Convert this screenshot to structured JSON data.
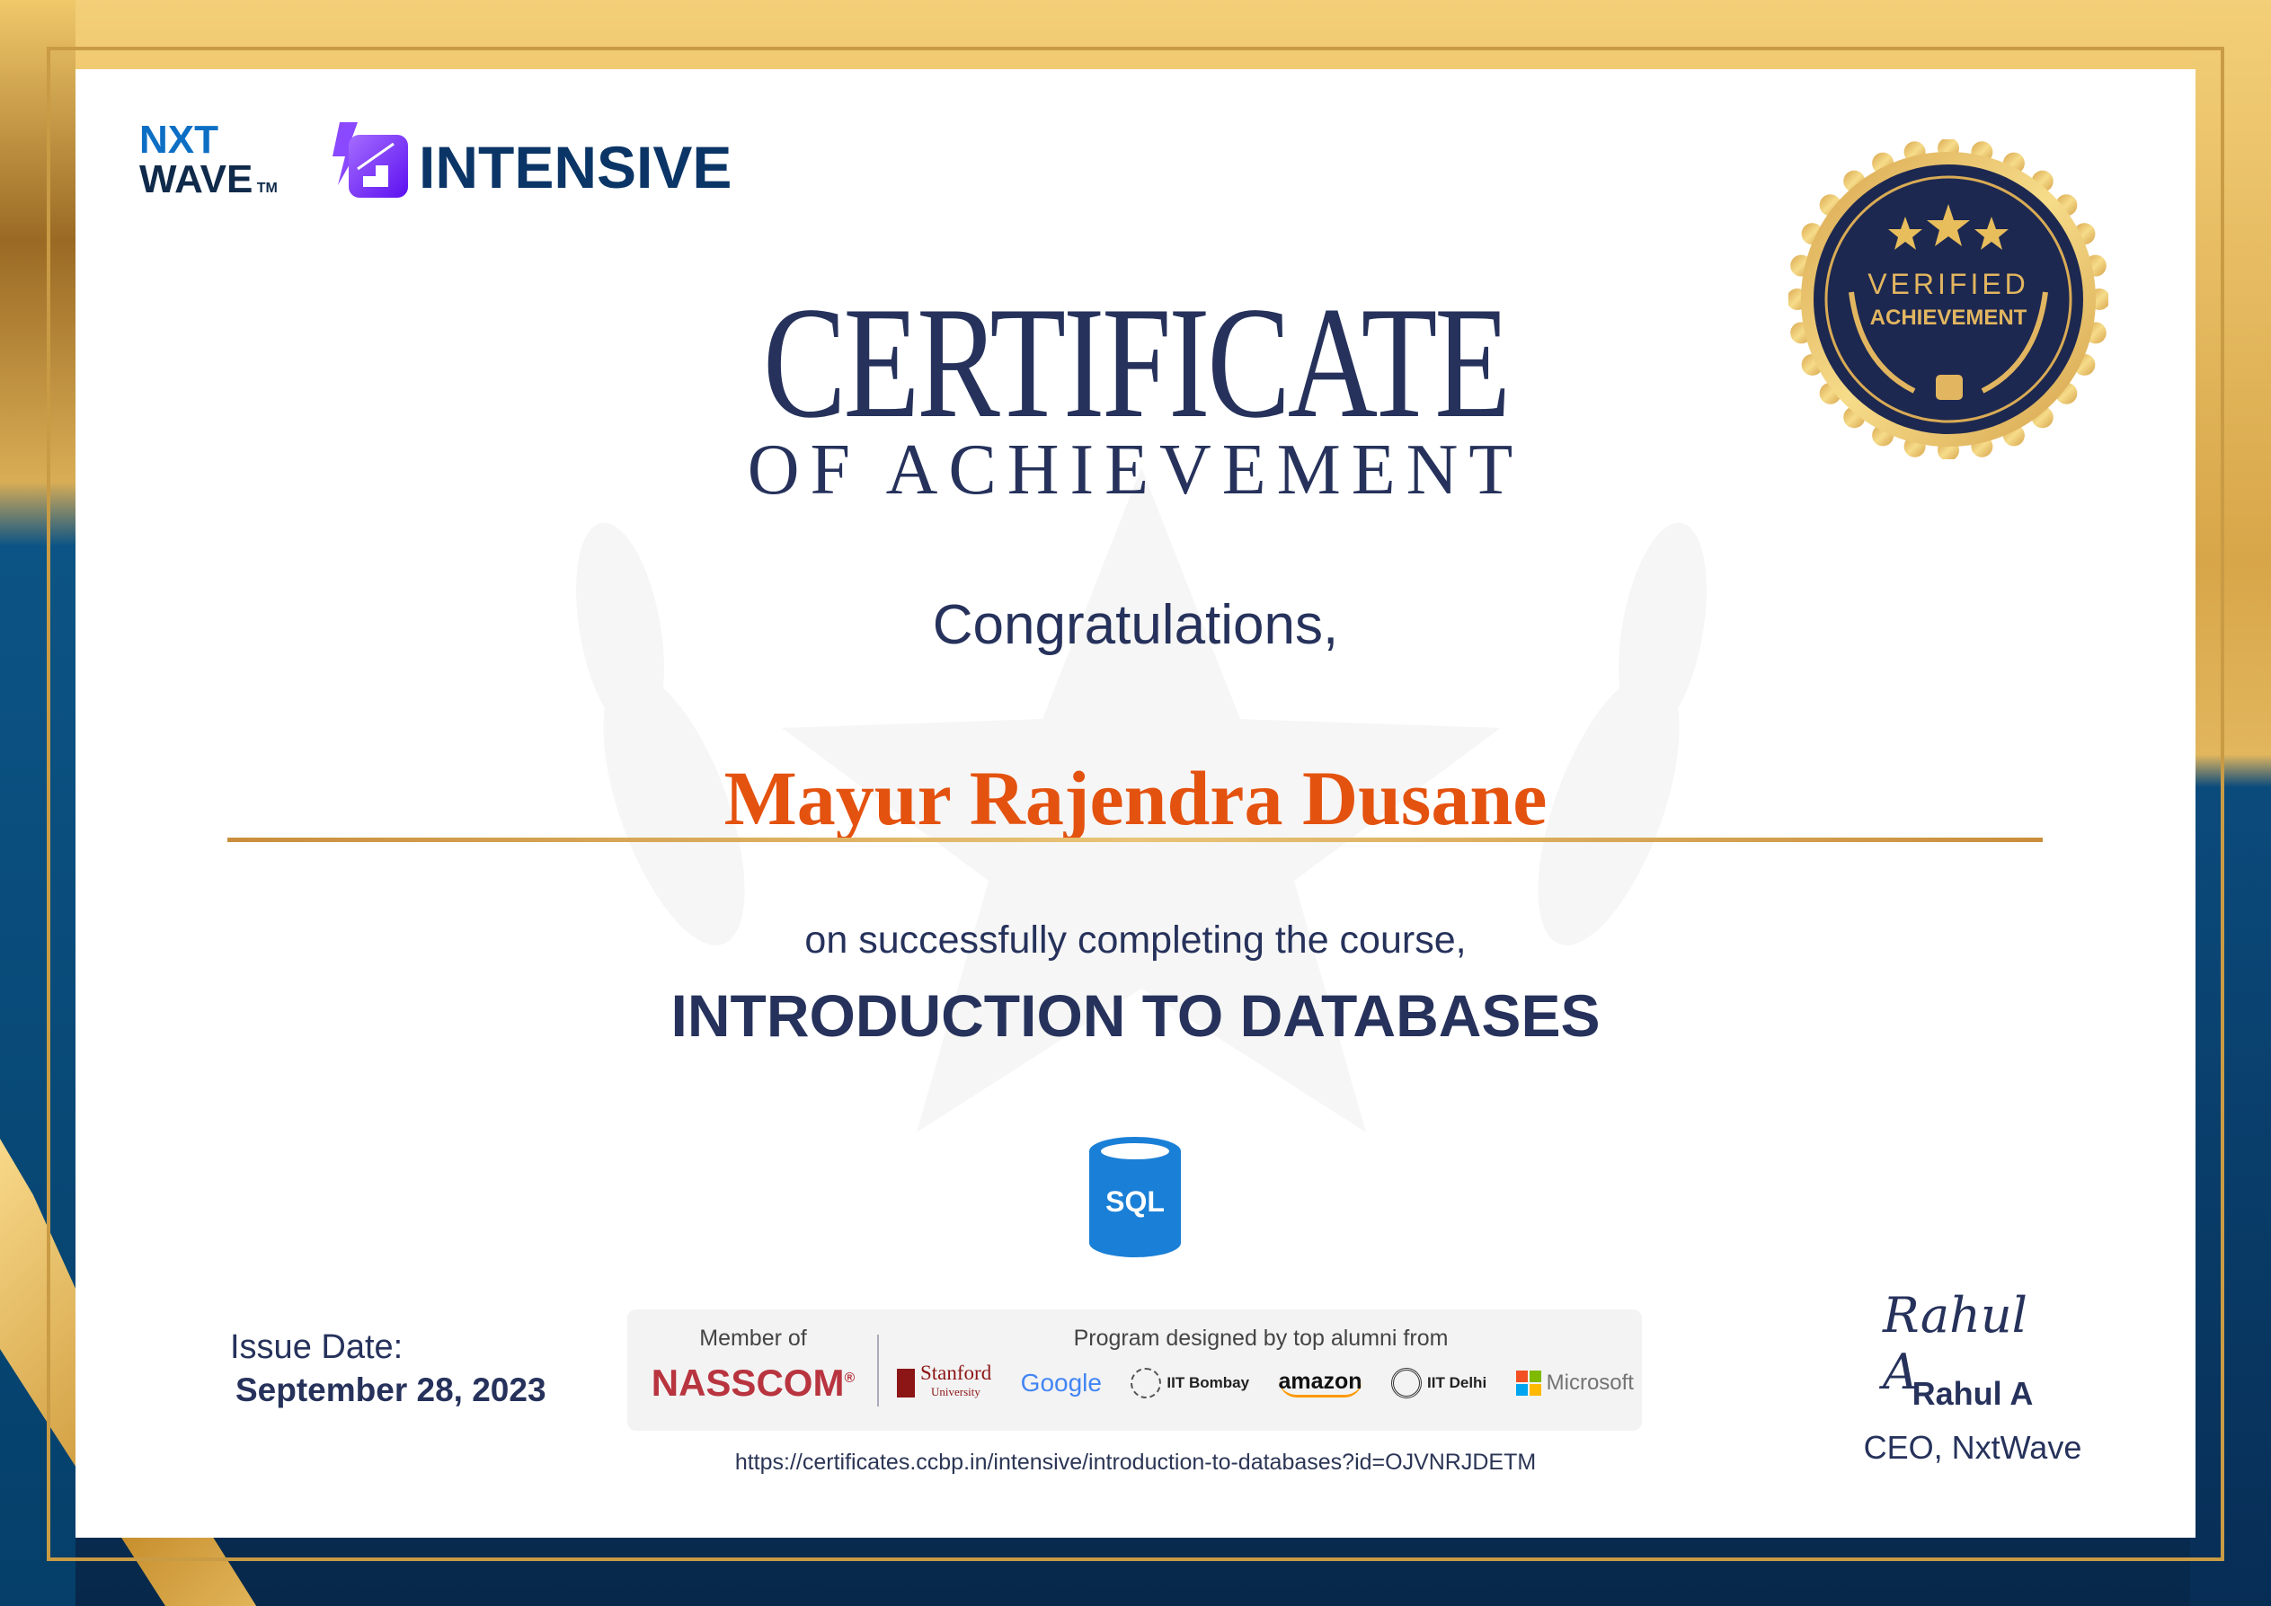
{
  "logos": {
    "nxtwave_line1": "NXT",
    "nxtwave_line2": "WAVE",
    "tm": "TM",
    "intensive": "INTENSIVE"
  },
  "seal": {
    "line1": "VERIFIED",
    "line2": "ACHIEVEMENT",
    "stars": 3
  },
  "title": "CERTIFICATE",
  "subtitle": "OF ACHIEVEMENT",
  "greeting": "Congratulations,",
  "recipient": "Mayur Rajendra Dusane",
  "completion_text": "on successfully completing the course,",
  "course": "INTRODUCTION TO DATABASES",
  "course_icon": {
    "label": "SQL",
    "name": "sql-database-icon"
  },
  "issue": {
    "label": "Issue Date:",
    "date": "September 28, 2023"
  },
  "membership": {
    "label": "Member of",
    "org": "NASSCOM",
    "reg": "®"
  },
  "alumni": {
    "label": "Program designed by top alumni from",
    "partners": [
      "Stanford",
      "University",
      "Google",
      "IIT Bombay",
      "amazon",
      "IIT Delhi",
      "Microsoft"
    ]
  },
  "url": "https://certificates.ccbp.in/intensive/introduction-to-databases?id=OJVNRJDETM",
  "signatory": {
    "signature": "Rahul A",
    "name": "Rahul A",
    "title": "CEO, NxtWave"
  },
  "colors": {
    "navy": "#26325b",
    "name_orange": "#e4520f",
    "gold": "#d9ab55",
    "intensive_purple": "#7b3cf5"
  }
}
